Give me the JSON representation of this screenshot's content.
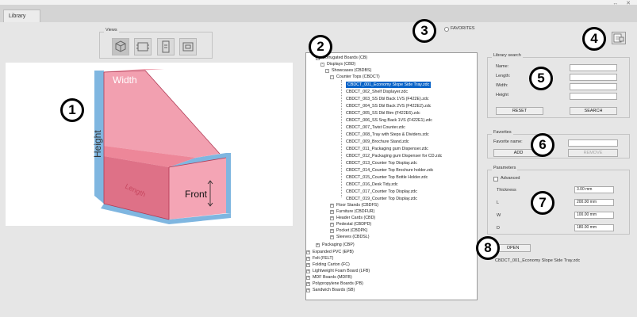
{
  "window": {
    "controls": "↔ ✕"
  },
  "tabs": [
    {
      "label": "Library"
    }
  ],
  "views": {
    "label": "Views",
    "buttons": [
      {
        "name": "view-3d-button",
        "icon": "cube-icon"
      },
      {
        "name": "view-front-button",
        "icon": "front-view-icon"
      },
      {
        "name": "view-side-button",
        "icon": "side-view-icon"
      },
      {
        "name": "view-top-button",
        "icon": "top-view-icon"
      }
    ]
  },
  "preview": {
    "label_width": "Width",
    "label_height": "Height",
    "label_length": "Length",
    "label_front": "Front"
  },
  "favorites_toggle": {
    "label": "FAVORITES"
  },
  "tree": {
    "items": [
      {
        "label": "Corrugated Boards (CB)"
      },
      {
        "label": "Displays (CBD)"
      },
      {
        "label": "Showcases (CBDBS)"
      },
      {
        "label": "Counter Tops (CBDCT)"
      },
      {
        "label": "CBDCT_001_Economy Slope Side Tray.zdc"
      },
      {
        "label": "CBDCT_002_Shelf Displayer.zdc"
      },
      {
        "label": "CBDCT_003_SS Dbl Back 1VS (F422E).zdc"
      },
      {
        "label": "CBDCT_004_SS Dbl Back 2VS (F422E2).zdc"
      },
      {
        "label": "CBDCT_005_SS Dbl Btm (F422E6).zdc"
      },
      {
        "label": "CBDCT_006_SS Sng Back 1VS (F422E1).zdc"
      },
      {
        "label": "CBDCT_007_Twist Counter.zdc"
      },
      {
        "label": "CBDCT_008_Tray with Steps & Dividers.zdc"
      },
      {
        "label": "CBDCT_009_Brochure Stand.zdc"
      },
      {
        "label": "CBDCT_011_Packaging gum Dispenser.zdc"
      },
      {
        "label": "CBDCT_012_Packaging gum Dispenser for CD.zdc"
      },
      {
        "label": "CBDCT_013_Counter Top Display.zdc"
      },
      {
        "label": "CBDCT_014_Counter Top Brochure holder.zdc"
      },
      {
        "label": "CBDCT_015_Counter Top Bottle Holder.zdc"
      },
      {
        "label": "CBDCT_016_Desk Tidy.zdc"
      },
      {
        "label": "CBDCT_017_Counter Top Display.zdc"
      },
      {
        "label": "CBDCT_019_Counter Top Display.zdc"
      },
      {
        "label": "Floor Stands (CBDFS)"
      },
      {
        "label": "Furniture (CBDFUR)"
      },
      {
        "label": "Header Cards (CBD)"
      },
      {
        "label": "Pedestal (CBDPD)"
      },
      {
        "label": "Pocket (CBDPK)"
      },
      {
        "label": "Sleeves (CBDSL)"
      },
      {
        "label": "Packaging (CBP)"
      },
      {
        "label": "Expanded PVC (EPB)"
      },
      {
        "label": "Felt (FELT)"
      },
      {
        "label": "Folding Carton (FC)"
      },
      {
        "label": "Lightweight Foam Board (LFB)"
      },
      {
        "label": "MDF Boards (MDFB)"
      },
      {
        "label": "Polypropylene Boards (PB)"
      },
      {
        "label": "Sandwich Boards (SB)"
      }
    ]
  },
  "search": {
    "label": "Library search",
    "fields": [
      {
        "label": "Name:",
        "value": ""
      },
      {
        "label": "Length:",
        "value": ""
      },
      {
        "label": "Width:",
        "value": ""
      },
      {
        "label": "Height",
        "value": ""
      }
    ],
    "reset_label": "RESET",
    "search_label": "SEARCH"
  },
  "favorites": {
    "label": "Favorites",
    "name_label": "Favorite name:",
    "name_value": "",
    "add_label": "ADD",
    "remove_label": "REMOVE"
  },
  "parameters": {
    "label": "Parameters",
    "advanced_label": "Advanced",
    "rows": [
      {
        "label": "Thickness",
        "value": "3.00 mm"
      },
      {
        "label": "L",
        "value": "200.00 mm"
      },
      {
        "label": "W",
        "value": "100.00 mm"
      },
      {
        "label": "D",
        "value": "180.00 mm"
      }
    ]
  },
  "open": {
    "label": "OPEN",
    "filename": "CBDCT_001_Economy Slope Side Tray.zdc"
  },
  "callouts": [
    "1",
    "2",
    "3",
    "4",
    "5",
    "6",
    "7",
    "8"
  ],
  "colors": {
    "selection": "#0a64c8",
    "box_pink": "#e8697f",
    "box_blue": "#7fb6e0"
  }
}
